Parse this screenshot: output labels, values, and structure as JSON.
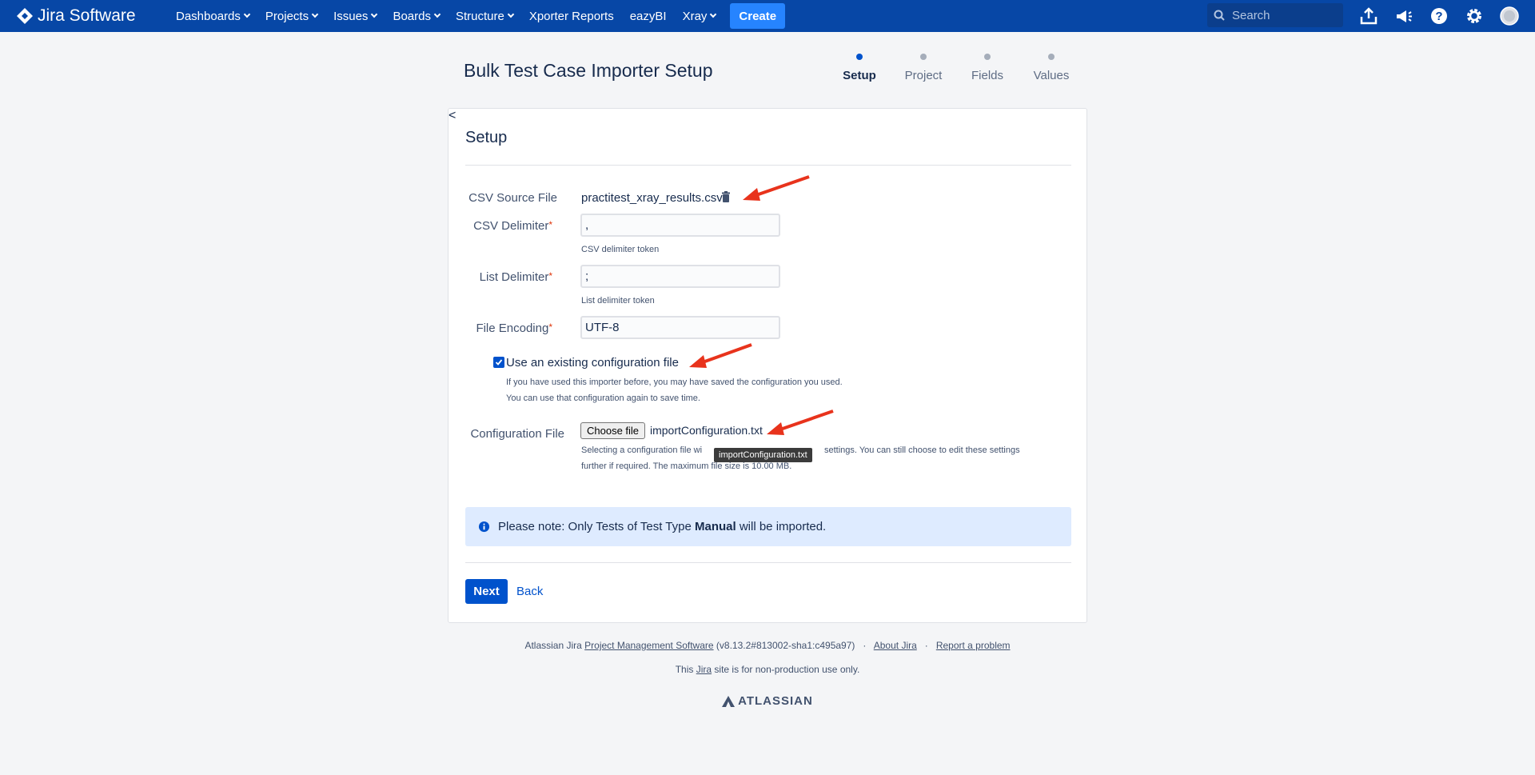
{
  "app": {
    "name": "Jira Software"
  },
  "nav": {
    "items": [
      {
        "label": "Dashboards",
        "dropdown": true
      },
      {
        "label": "Projects",
        "dropdown": true
      },
      {
        "label": "Issues",
        "dropdown": true
      },
      {
        "label": "Boards",
        "dropdown": true
      },
      {
        "label": "Structure",
        "dropdown": true
      },
      {
        "label": "Xporter Reports",
        "dropdown": false
      },
      {
        "label": "eazyBI",
        "dropdown": false
      },
      {
        "label": "Xray",
        "dropdown": true
      }
    ],
    "create_label": "Create",
    "search_placeholder": "Search",
    "icons": [
      "upload-icon",
      "megaphone-icon",
      "help-icon",
      "gear-icon",
      "avatar"
    ]
  },
  "page": {
    "title": "Bulk Test Case Importer Setup"
  },
  "stages": [
    {
      "label": "Setup",
      "active": true
    },
    {
      "label": "Project",
      "active": false
    },
    {
      "label": "Fields",
      "active": false
    },
    {
      "label": "Values",
      "active": false
    }
  ],
  "form": {
    "heading": "Setup",
    "csv_source_label": "CSV Source File",
    "csv_source_value": "practitest_xray_results.csv",
    "csv_delimiter_label": "CSV Delimiter",
    "csv_delimiter_value": ",",
    "csv_delimiter_desc": "CSV delimiter token",
    "list_delimiter_label": "List Delimiter",
    "list_delimiter_value": ";",
    "list_delimiter_desc": "List delimiter token",
    "file_encoding_label": "File Encoding",
    "file_encoding_value": "UTF-8",
    "required_mark": "*",
    "use_config_label": "Use an existing configuration file",
    "use_config_checked": true,
    "use_config_desc_1": "If you have used this importer before, you may have saved the configuration you used.",
    "use_config_desc_2": "You can use that configuration again to save time.",
    "config_file_label": "Configuration File",
    "choose_file_label": "Choose file",
    "config_file_value": "importConfiguration.txt",
    "config_desc_1": "Selecting a configuration file wi",
    "config_desc_1b": "settings. You can still choose to edit these settings",
    "config_desc_2": "further if required. The maximum file size is 10.00 MB.",
    "tooltip": "importConfiguration.txt",
    "note_prefix": "Please note: Only Tests of Test Type ",
    "note_bold": "Manual",
    "note_suffix": " will be imported.",
    "next_label": "Next",
    "back_label": "Back"
  },
  "footer": {
    "prefix": "Atlassian Jira ",
    "link1": "Project Management Software",
    "version": " (v8.13.2#813002-sha1:c495a97)",
    "sep": "·",
    "link2": "About Jira",
    "link3": "Report a problem",
    "line2_prefix": "This ",
    "line2_link": "Jira",
    "line2_suffix": " site is for non-production use only.",
    "brand": "ATLASSIAN"
  },
  "colors": {
    "nav_bg": "#0747a6",
    "primary": "#0052cc",
    "annotation_arrow": "#e8331c"
  }
}
